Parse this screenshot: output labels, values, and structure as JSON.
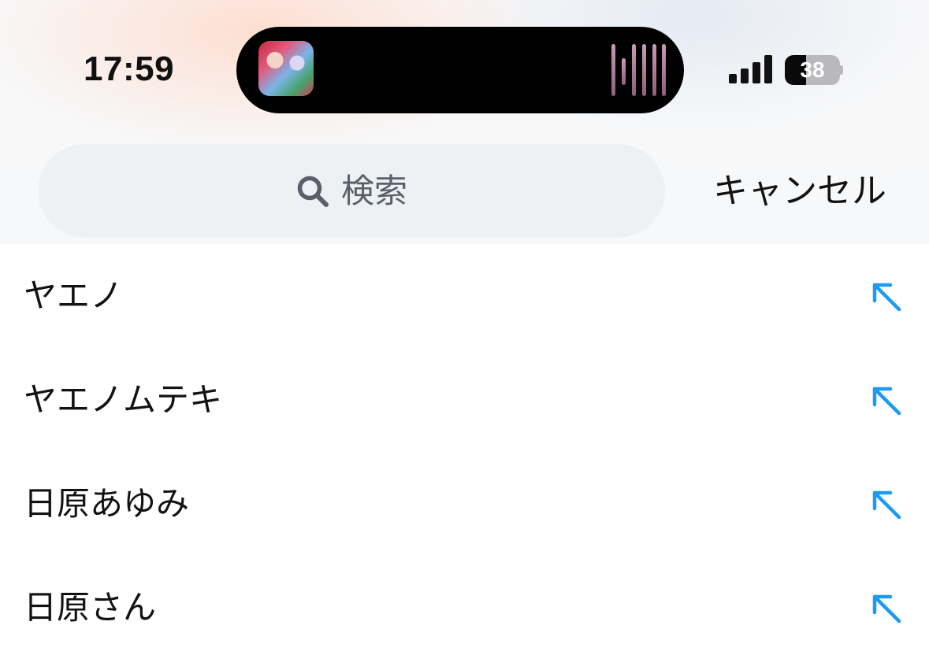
{
  "status_bar": {
    "time": "17:59",
    "battery_level": "38",
    "battery_fraction": 0.38,
    "signal_bars": 4,
    "icons": [
      "album-art",
      "audio-waveform-icon",
      "cellular-signal-icon",
      "battery-icon"
    ]
  },
  "search": {
    "placeholder": "検索",
    "icon": "search-icon",
    "cancel_label": "キャンセル"
  },
  "suggestions": [
    {
      "text": "ヤエノ",
      "icon": "arrow-up-left-icon"
    },
    {
      "text": "ヤエノムテキ",
      "icon": "arrow-up-left-icon"
    },
    {
      "text": "日原あゆみ",
      "icon": "arrow-up-left-icon"
    },
    {
      "text": "日原さん",
      "icon": "arrow-up-left-icon"
    }
  ],
  "colors": {
    "accent": "#1d9bf0",
    "text": "#121212",
    "search_field_bg": "#eef1f3",
    "placeholder": "#59606a"
  }
}
